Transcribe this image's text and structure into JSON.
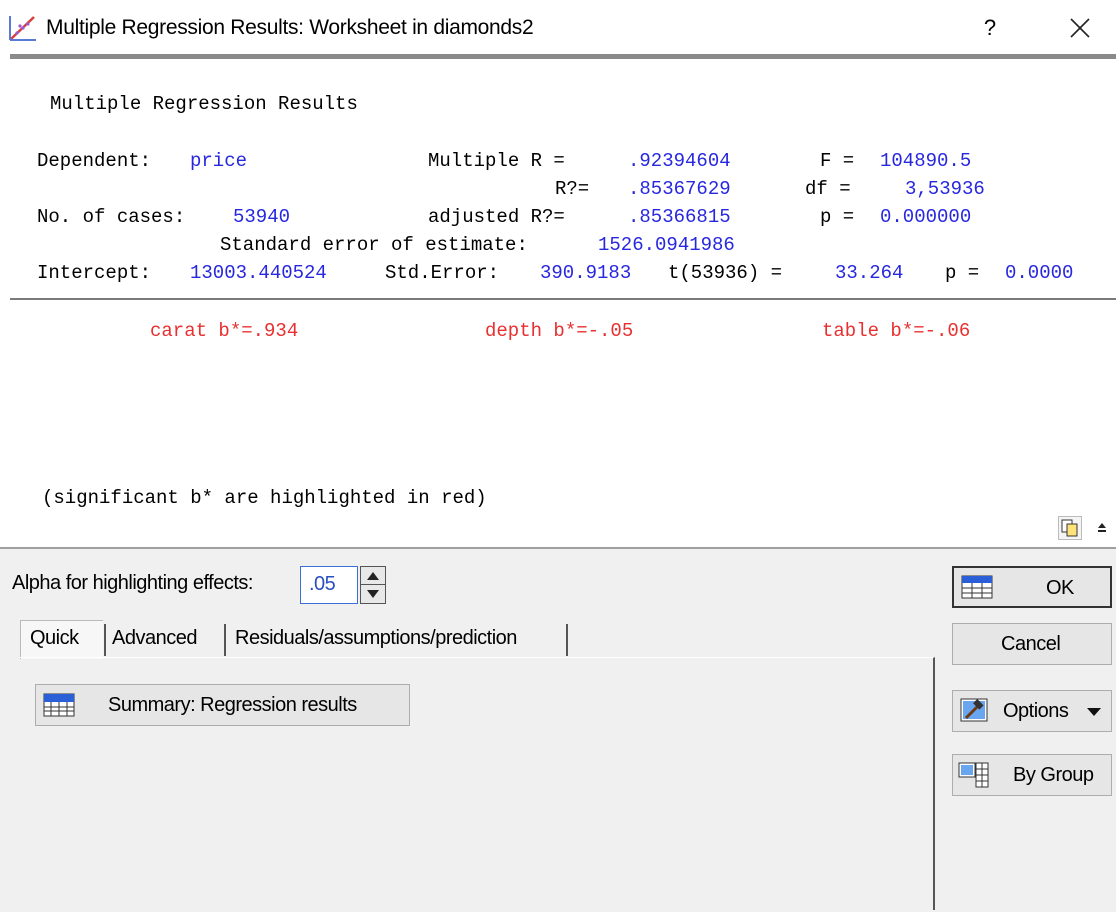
{
  "window": {
    "title": "Multiple Regression Results: Worksheet in diamonds2",
    "help_label": "?"
  },
  "results": {
    "heading": "Multiple Regression Results",
    "dependent_label": "Dependent:",
    "dependent_value": "price",
    "multiple_r_label": "Multiple R =",
    "multiple_r_value": ".92394604",
    "f_label": "F =",
    "f_value": "104890.5",
    "r2_label": "R?=",
    "r2_value": ".85367629",
    "df_label": "df =",
    "df_value": "3,53936",
    "cases_label": "No. of cases:",
    "cases_value": "53940",
    "adj_r2_label": "adjusted R?=",
    "adj_r2_value": ".85366815",
    "p_label": "p =",
    "p_value": "0.000000",
    "se_label": "Standard error of estimate:",
    "se_value": "1526.0941986",
    "intercept_label": "Intercept:",
    "intercept_value": "13003.440524",
    "stderr_label": "Std.Error:",
    "stderr_value": "390.9183",
    "t_label": "t(53936) =",
    "t_value": "33.264",
    "p2_label": "p =",
    "p2_value": "0.0000",
    "effects": [
      "carat b*=.934",
      "depth b*=-.05",
      "table b*=-.06"
    ],
    "note": "(significant b* are highlighted in red)"
  },
  "controls": {
    "alpha_label": "Alpha for highlighting effects:",
    "alpha_value": ".05",
    "tabs": [
      "Quick",
      "Advanced",
      "Residuals/assumptions/prediction"
    ],
    "summary_button": "Summary:  Regression results",
    "ok_button": "OK",
    "cancel_button": "Cancel",
    "options_button": "Options",
    "by_group_button": "By Group"
  },
  "colors": {
    "value_blue": "#2727e0",
    "significant_red": "#e83030",
    "panel_bg": "#f0f0f0"
  }
}
